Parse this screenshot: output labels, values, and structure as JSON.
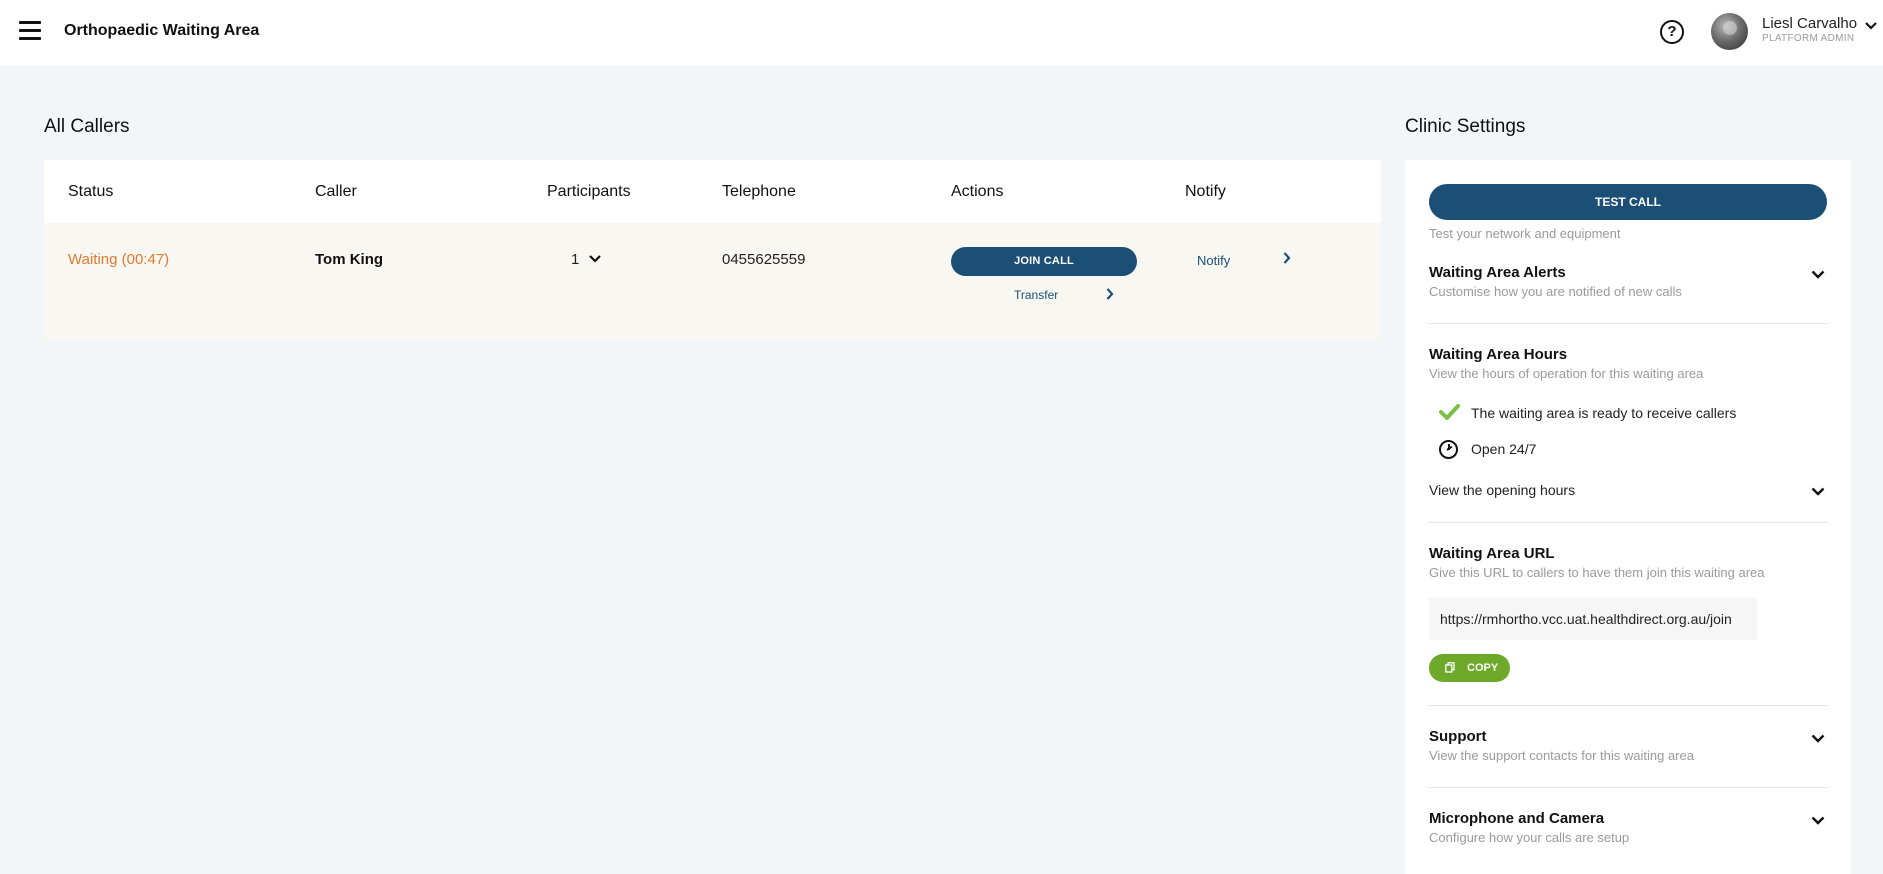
{
  "header": {
    "title": "Orthopaedic Waiting Area",
    "help_icon": "help-circle-icon",
    "user_name": "Liesl Carvalho",
    "user_role": "PLATFORM ADMIN"
  },
  "callers": {
    "title": "All Callers",
    "columns": [
      "Status",
      "Caller",
      "Participants",
      "Telephone",
      "Actions",
      "Notify"
    ],
    "rows": [
      {
        "status": "Waiting (00:47)",
        "caller": "Tom King",
        "participants": "1",
        "telephone": "0455625559",
        "join_label": "JOIN CALL",
        "transfer_label": "Transfer",
        "notify_label": "Notify"
      }
    ]
  },
  "settings": {
    "title": "Clinic Settings",
    "test_call_label": "TEST CALL",
    "test_call_sub": "Test your network and equipment",
    "alerts_title": "Waiting Area Alerts",
    "alerts_sub": "Customise how you are notified of new calls",
    "hours_title": "Waiting Area Hours",
    "hours_sub": "View the hours of operation for this waiting area",
    "ready_text": "The waiting area is ready to receive callers",
    "open_text": "Open 24/7",
    "opening_hours_link": "View the opening hours",
    "url_title": "Waiting Area URL",
    "url_sub": "Give this URL to callers to have them join this waiting area",
    "url_value": "https://rmhortho.vcc.uat.healthdirect.org.au/join",
    "copy_label": "COPY",
    "support_title": "Support",
    "support_sub": "View the support contacts for this waiting area",
    "mic_title": "Microphone and Camera",
    "mic_sub": "Configure how your calls are setup"
  },
  "colors": {
    "primary": "#1b4f76",
    "waiting_status": "#e37a2f",
    "copy_green": "#6ea92a",
    "check_green": "#79c142"
  }
}
